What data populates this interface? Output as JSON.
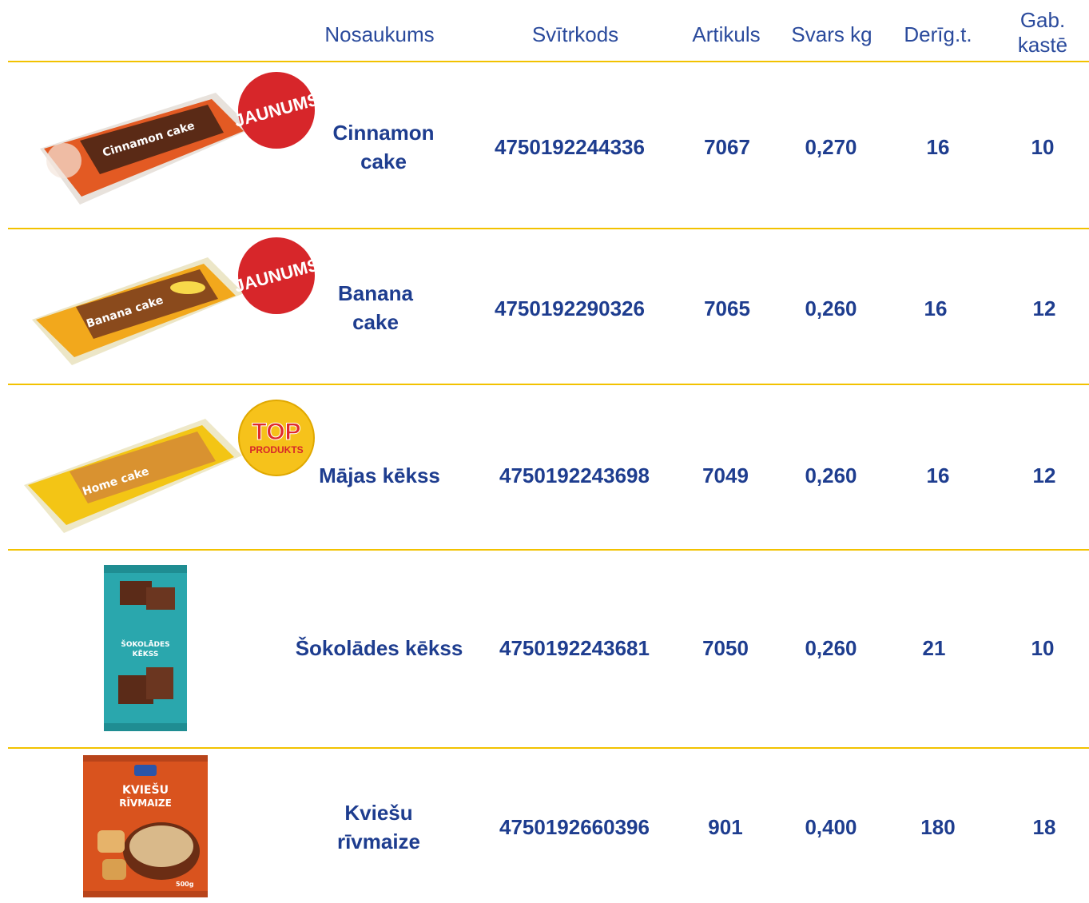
{
  "header": {
    "name": "Nosaukums",
    "barcode": "Svītrkods",
    "article": "Artikuls",
    "weight": "Svars kg",
    "shelf_life": "Derīg.t.",
    "per_box_line1": "Gab.",
    "per_box_line2": "kastē"
  },
  "colors": {
    "accent_rule": "#f2c200",
    "text": "#1e3d8f",
    "badge_red": "#d7262a",
    "badge_yellow": "#f6c21b"
  },
  "products": [
    {
      "name_line1": "Cinnamon",
      "name_line2": "cake",
      "barcode": "4750192244336",
      "article": "7067",
      "weight": "0,270",
      "shelf_life": "16",
      "per_box": "10",
      "badge": "JAUNUMS",
      "pack_text": "Cinnamon cake",
      "pack_icon": "cinnamon-cake-pack-icon"
    },
    {
      "name_line1": "Banana",
      "name_line2": "cake",
      "barcode": "4750192290326",
      "article": "7065",
      "weight": "0,260",
      "shelf_life": "16",
      "per_box": "12",
      "badge": "JAUNUMS",
      "pack_text": "Banana cake",
      "pack_icon": "banana-cake-pack-icon"
    },
    {
      "name_line1": "Mājas kēkss",
      "name_line2": "",
      "barcode": "4750192243698",
      "article": "7049",
      "weight": "0,260",
      "shelf_life": "16",
      "per_box": "12",
      "badge_top": "TOP",
      "badge_bottom": "PRODUKTS",
      "pack_text": "Home cake",
      "pack_icon": "home-cake-pack-icon"
    },
    {
      "name_line1": "Šokolādes kēkss",
      "name_line2": "",
      "barcode": "4750192243681",
      "article": "7050",
      "weight": "0,260",
      "shelf_life": "21",
      "per_box": "10",
      "pack_text_1": "ŠOKOLĀDES",
      "pack_text_2": "KĒKSS",
      "pack_icon": "chocolate-cake-pack-icon"
    },
    {
      "name_line1": "Kviešu",
      "name_line2": "rīvmaize",
      "barcode": "4750192660396",
      "article": "901",
      "weight": "0,400",
      "shelf_life": "180",
      "per_box": "18",
      "pack_text_1": "KVIEŠU",
      "pack_text_2": "RĪVMAIZE",
      "pack_weight": "500g",
      "pack_icon": "breadcrumbs-pack-icon"
    }
  ]
}
